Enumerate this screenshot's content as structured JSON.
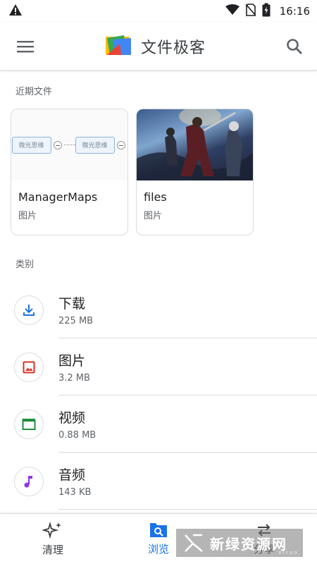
{
  "status_bar": {
    "time": "16:16"
  },
  "app_bar": {
    "title": "文件极客"
  },
  "recent": {
    "label": "近期文件",
    "cards": [
      {
        "name": "ManagerMaps",
        "type": "图片",
        "thumb_label": "微光思维"
      },
      {
        "name": "files",
        "type": "图片"
      }
    ]
  },
  "categories": {
    "label": "类别",
    "items": [
      {
        "name": "下载",
        "size": "225 MB",
        "icon": "download-icon",
        "color": "#1a73e8"
      },
      {
        "name": "图片",
        "size": "3.2 MB",
        "icon": "image-icon",
        "color": "#d93025"
      },
      {
        "name": "视频",
        "size": "0.88 MB",
        "icon": "video-icon",
        "color": "#1e8e3e"
      },
      {
        "name": "音频",
        "size": "143 KB",
        "icon": "audio-icon",
        "color": "#9334e6"
      }
    ]
  },
  "bottom_nav": {
    "items": [
      {
        "label": "清理",
        "icon": "sparkle-icon",
        "active": false
      },
      {
        "label": "浏览",
        "icon": "browse-icon",
        "active": true
      },
      {
        "label": "分享",
        "icon": "share-icon",
        "active": false
      }
    ]
  },
  "watermark": {
    "text": "新绿资源网",
    "sub": "x i r u o"
  },
  "colors": {
    "accent": "#1a73e8",
    "divider": "#dadce0"
  }
}
